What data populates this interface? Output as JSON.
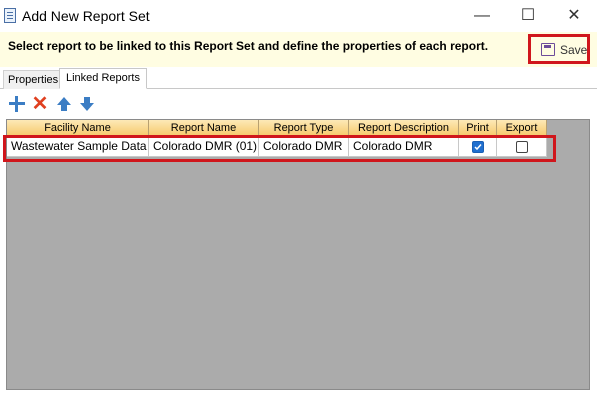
{
  "window": {
    "title": "Add New Report Set",
    "minimize_glyph": "—",
    "maximize_glyph": "☐",
    "close_glyph": "✕"
  },
  "banner": {
    "instruction": "Select report to be linked to this Report Set and define the properties of each report.",
    "save_label": "Save",
    "save_icon": "floppy-disk-icon"
  },
  "tabs": [
    {
      "label": "Properties",
      "active": false
    },
    {
      "label": "Linked Reports",
      "active": true
    }
  ],
  "toolbar": {
    "add_icon": "plus-icon",
    "delete_icon": "delete-x-icon",
    "move_up_icon": "arrow-up-icon",
    "move_down_icon": "arrow-down-icon"
  },
  "grid": {
    "columns": [
      "Facility Name",
      "Report Name",
      "Report Type",
      "Report Description",
      "Print",
      "Export"
    ],
    "rows": [
      {
        "facility_name": "Wastewater Sample Data",
        "report_name": "Colorado DMR (01)",
        "report_type": "Colorado DMR",
        "report_description": "Colorado DMR",
        "print": true,
        "export": false
      }
    ]
  },
  "colors": {
    "highlight": "#d0161c",
    "header_gradient_top": "#fde9b7",
    "header_gradient_bottom": "#f6c96b",
    "banner_background": "#fffde2",
    "grid_background": "#ababab",
    "checkbox_checked": "#1f6fcf"
  }
}
